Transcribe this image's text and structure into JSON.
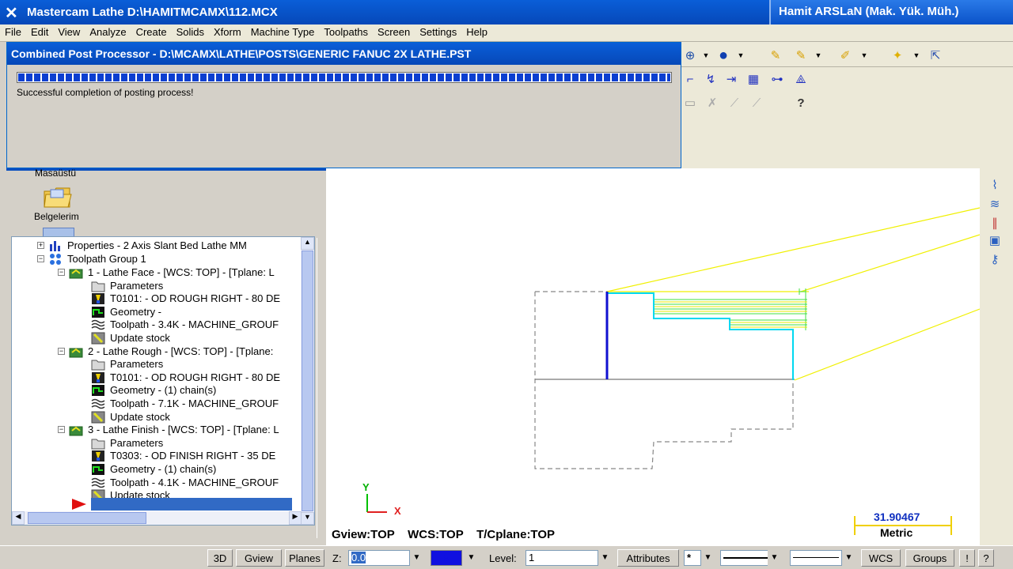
{
  "window": {
    "title": "Mastercam Lathe  D:\\HAMITMCAMX\\112.MCX",
    "author_banner": "Hamit ARSLaN (Mak. Yük. Müh.)"
  },
  "menu": [
    "File",
    "Edit",
    "View",
    "Analyze",
    "Create",
    "Solids",
    "Xform",
    "Machine Type",
    "Toolpaths",
    "Screen",
    "Settings",
    "Help"
  ],
  "post_dialog": {
    "title": "Combined Post Processor - D:\\MCAMX\\LATHE\\POSTS\\GENERIC FANUC 2X LATHE.PST",
    "progress": 1.0,
    "message": "Successful completion of posting process!"
  },
  "desktop": {
    "partial_label": "Masaüstü",
    "folder_label": "Belgelerim"
  },
  "tree": {
    "properties": "Properties - 2 Axis Slant Bed Lathe MM",
    "group": "Toolpath Group 1",
    "operations": [
      {
        "label": "1 - Lathe Face - [WCS: TOP] - [Tplane: L",
        "parameters": "Parameters",
        "tool": "T0101: - OD ROUGH RIGHT - 80 DE",
        "geometry": "Geometry -",
        "toolpath": "Toolpath - 3.4K - MACHINE_GROUF",
        "stock": "Update stock"
      },
      {
        "label": "2 - Lathe Rough - [WCS: TOP] - [Tplane:",
        "parameters": "Parameters",
        "tool": "T0101: - OD ROUGH RIGHT - 80 DE",
        "geometry": "Geometry - (1) chain(s)",
        "toolpath": "Toolpath - 7.1K - MACHINE_GROUF",
        "stock": "Update stock"
      },
      {
        "label": "3 - Lathe Finish - [WCS: TOP] - [Tplane: L",
        "parameters": "Parameters",
        "tool": "T0303: - OD FINISH RIGHT - 35 DE",
        "geometry": "Geometry - (1) chain(s)",
        "toolpath": "Toolpath - 4.1K - MACHINE_GROUF",
        "stock": "Update stock"
      }
    ]
  },
  "graphics": {
    "axis_y": "Y",
    "axis_x": "X",
    "view_info": "Gview:TOP    WCS:TOP    T/Cplane:TOP",
    "scale_value": "31.90467",
    "scale_unit": "Metric"
  },
  "statusbar": {
    "btn_3d": "3D",
    "btn_gview": "Gview",
    "btn_planes": "Planes",
    "z_label": "Z:",
    "z_value": "0.0",
    "color_value": "9",
    "level_label": "Level:",
    "level_value": "1",
    "attributes": "Attributes",
    "point_style": "*",
    "wcs": "WCS",
    "groups": "Groups",
    "bang": "!",
    "help": "?"
  },
  "colors": {
    "title_blue": "#0648b8",
    "progress_blue": "#0c3fd0",
    "path_yellow": "#f0f000",
    "path_cyan": "#00d8f0",
    "path_green": "#40e040",
    "geometry_blue": "#0000cc",
    "scale_blue": "#1030c0"
  }
}
